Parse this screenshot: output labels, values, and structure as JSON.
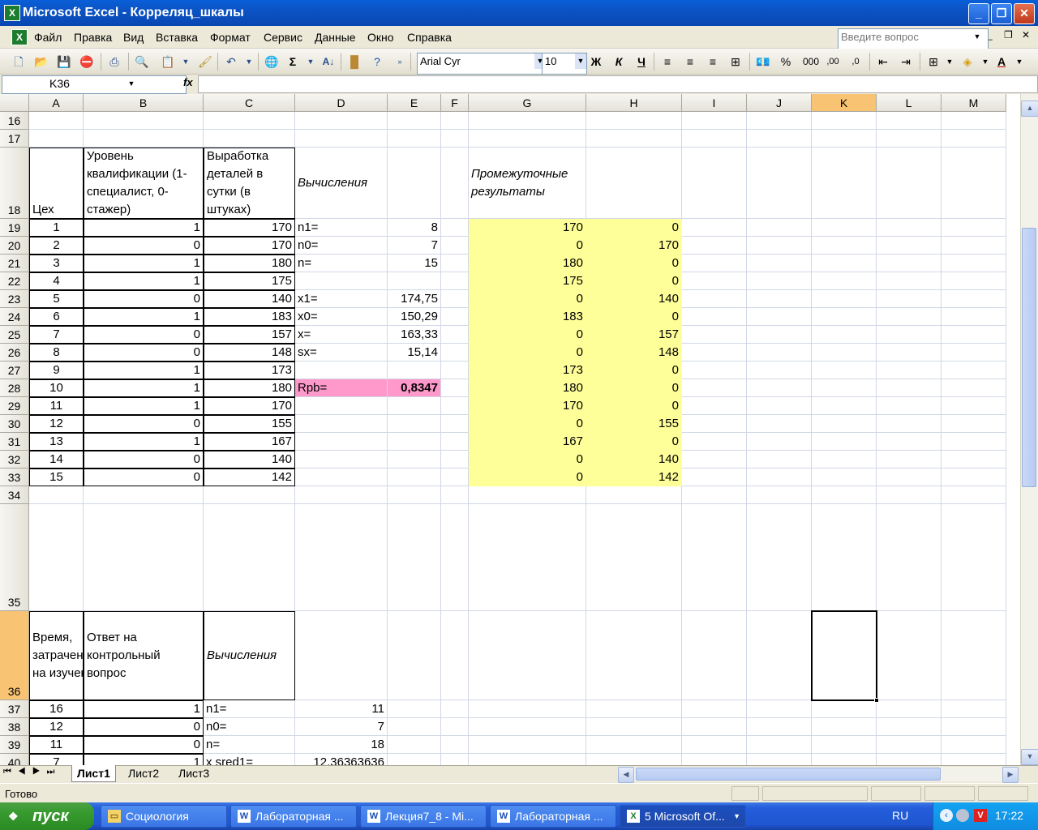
{
  "window": {
    "title": "Microsoft Excel - Корреляц_шкалы",
    "min": "_",
    "max": "❐",
    "close": "✕"
  },
  "menu": {
    "items": [
      "Файл",
      "Правка",
      "Вид",
      "Вставка",
      "Формат",
      "Сервис",
      "Данные",
      "Окно",
      "Справка"
    ],
    "ask_placeholder": "Введите вопрос"
  },
  "toolbar": {
    "font": "Arial Cyr",
    "size": "10",
    "bold": "Ж",
    "italic": "К",
    "underline": "Ч",
    "percent": "%",
    "thousands": "000"
  },
  "formula": {
    "namebox": "K36",
    "fx": "fx",
    "value": ""
  },
  "columns": [
    "A",
    "B",
    "C",
    "D",
    "E",
    "F",
    "G",
    "H",
    "I",
    "J",
    "K",
    "L",
    "M"
  ],
  "rows": {
    "16": {},
    "17": {},
    "18": {
      "A": "Цех",
      "B": "Уровень квалификации (1-специалист, 0-стажер)",
      "C": "Выработка деталей в сутки (в штуках)",
      "D": "Вычисления",
      "G": "Промежуточные результаты"
    },
    "19": {
      "A": "1",
      "B": "1",
      "C": "170",
      "D": "n1=",
      "E": "8",
      "G": "170",
      "H": "0"
    },
    "20": {
      "A": "2",
      "B": "0",
      "C": "170",
      "D": "n0=",
      "E": "7",
      "G": "0",
      "H": "170"
    },
    "21": {
      "A": "3",
      "B": "1",
      "C": "180",
      "D": "n=",
      "E": "15",
      "G": "180",
      "H": "0"
    },
    "22": {
      "A": "4",
      "B": "1",
      "C": "175",
      "G": "175",
      "H": "0"
    },
    "23": {
      "A": "5",
      "B": "0",
      "C": "140",
      "D": "x1=",
      "E": "174,75",
      "G": "0",
      "H": "140"
    },
    "24": {
      "A": "6",
      "B": "1",
      "C": "183",
      "D": "x0=",
      "E": "150,29",
      "G": "183",
      "H": "0"
    },
    "25": {
      "A": "7",
      "B": "0",
      "C": "157",
      "D": "x=",
      "E": "163,33",
      "G": "0",
      "H": "157"
    },
    "26": {
      "A": "8",
      "B": "0",
      "C": "148",
      "D": "sx=",
      "E": "15,14",
      "G": "0",
      "H": "148"
    },
    "27": {
      "A": "9",
      "B": "1",
      "C": "173",
      "G": "173",
      "H": "0"
    },
    "28": {
      "A": "10",
      "B": "1",
      "C": "180",
      "D": "Rpb=",
      "E": "0,8347",
      "G": "180",
      "H": "0"
    },
    "29": {
      "A": "11",
      "B": "1",
      "C": "170",
      "G": "170",
      "H": "0"
    },
    "30": {
      "A": "12",
      "B": "0",
      "C": "155",
      "G": "0",
      "H": "155"
    },
    "31": {
      "A": "13",
      "B": "1",
      "C": "167",
      "G": "167",
      "H": "0"
    },
    "32": {
      "A": "14",
      "B": "0",
      "C": "140",
      "G": "0",
      "H": "140"
    },
    "33": {
      "A": "15",
      "B": "0",
      "C": "142",
      "G": "0",
      "H": "142"
    },
    "34": {},
    "35": {},
    "36": {
      "A": "Время, затраченное на изучение",
      "B": "Ответ на контрольный вопрос",
      "C": "Вычисления"
    },
    "37": {
      "A": "16",
      "B": "1",
      "C": "n1=",
      "D": "11"
    },
    "38": {
      "A": "12",
      "B": "0",
      "C": "n0=",
      "D": "7"
    },
    "39": {
      "A": "11",
      "B": "0",
      "C": "n=",
      "D": "18"
    },
    "40": {
      "A": "7",
      "B": "1",
      "C": "x sred1=",
      "D": "12,36363636"
    }
  },
  "sheets": [
    "Лист1",
    "Лист2",
    "Лист3"
  ],
  "status": "Готово",
  "taskbar": {
    "start": "пуск",
    "tasks": [
      "Социология",
      "Лабораторная ...",
      "Лекция7_8 - Mi...",
      "Лабораторная ...",
      "5 Microsoft Of..."
    ],
    "lang": "RU",
    "clock": "17:22"
  }
}
